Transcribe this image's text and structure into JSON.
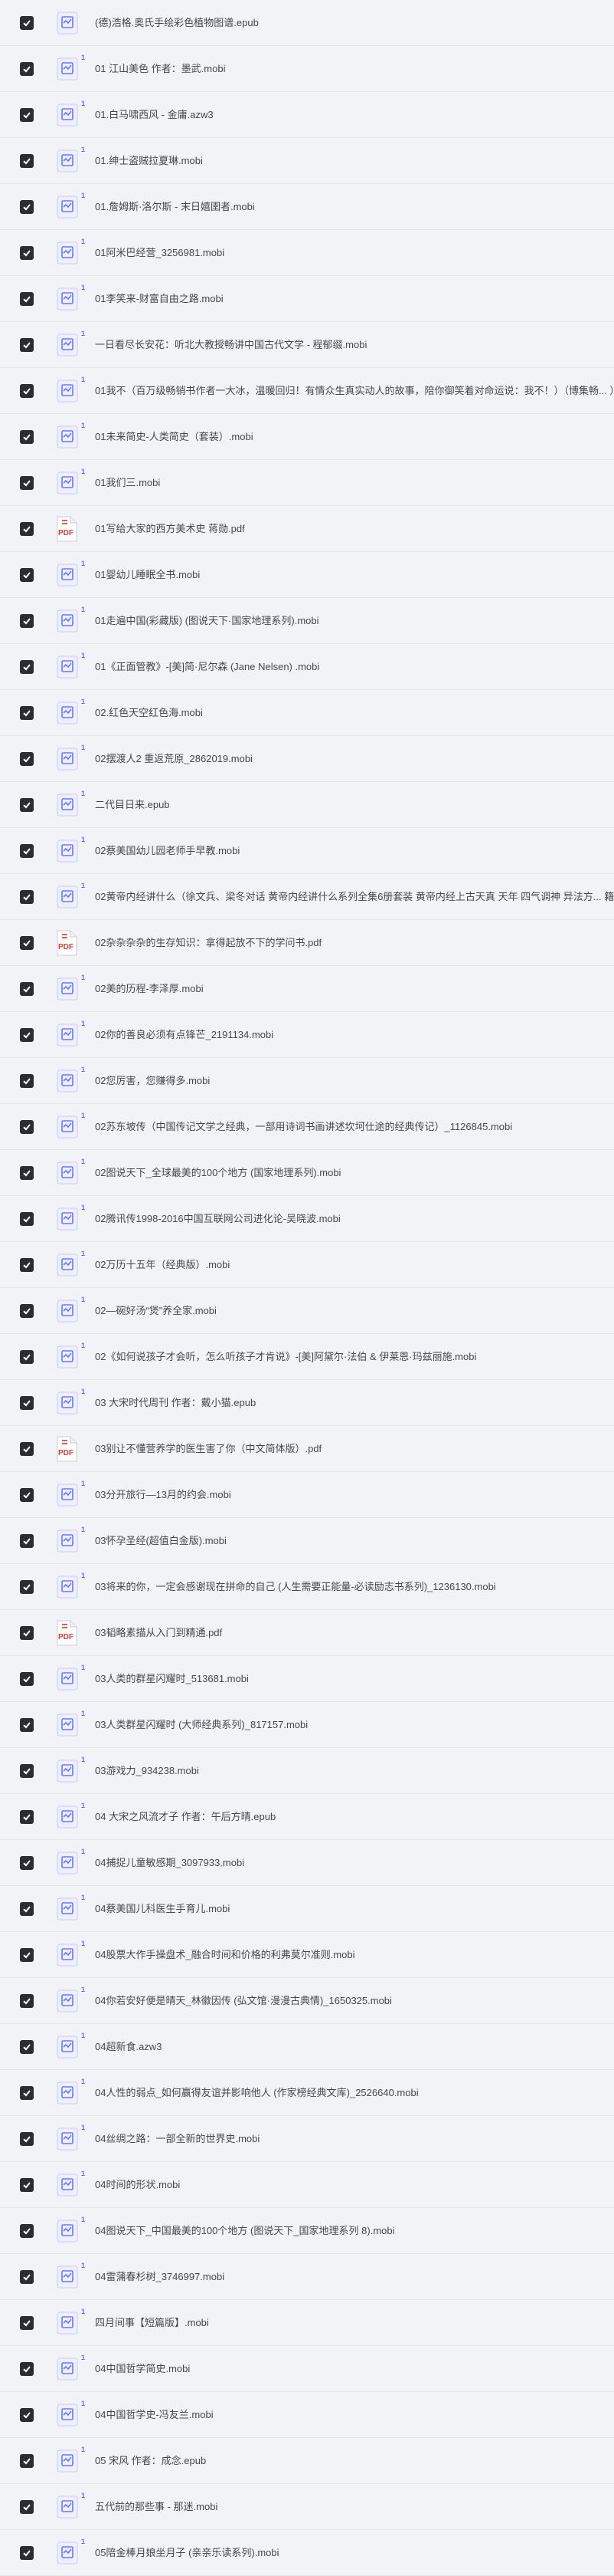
{
  "files": [
    {
      "name": "(德)浩格.奥氏手绘彩色植物图谱.epub",
      "type": "ebook",
      "count": ""
    },
    {
      "name": "01 江山美色 作者：墨武.mobi",
      "type": "ebook",
      "count": "1"
    },
    {
      "name": "01.白马啸西风 - 金庸.azw3",
      "type": "ebook",
      "count": "1"
    },
    {
      "name": "01.绅士盗贼拉夏琳.mobi",
      "type": "ebook",
      "count": "1"
    },
    {
      "name": "01.詹姆斯·洛尔斯 - 末日嬉圉者.mobi",
      "type": "ebook",
      "count": "1"
    },
    {
      "name": "01阿米巴经营_3256981.mobi",
      "type": "ebook",
      "count": "1"
    },
    {
      "name": "01李笑来-财富自由之路.mobi",
      "type": "ebook",
      "count": "1"
    },
    {
      "name": "一日看尽长安花：听北大教授畅讲中国古代文学 - 程郁缀.mobi",
      "type": "ebook",
      "count": "1"
    },
    {
      "name": "01我不（百万级畅销书作者一大冰，温暖回归！有情众生真实动人的故事，陪你御笑着对命运说：我不！）（博集畅... ）",
      "type": "ebook",
      "count": "1"
    },
    {
      "name": "01未来简史-人类简史（套装）.mobi",
      "type": "ebook",
      "count": "1"
    },
    {
      "name": "01我们三.mobi",
      "type": "ebook",
      "count": "1"
    },
    {
      "name": "01写给大家的西方美术史 蒋勋.pdf",
      "type": "pdf",
      "count": ""
    },
    {
      "name": "01婴幼儿睡眠全书.mobi",
      "type": "ebook",
      "count": "1"
    },
    {
      "name": "01走遍中国(彩藏版) (图说天下·国家地理系列).mobi",
      "type": "ebook",
      "count": "1"
    },
    {
      "name": "01《正面管教》-[美]简·尼尔森 (Jane Nelsen) .mobi",
      "type": "ebook",
      "count": "1"
    },
    {
      "name": "02.红色天空红色海.mobi",
      "type": "ebook",
      "count": "1"
    },
    {
      "name": "02摆渡人2 重返荒原_2862019.mobi",
      "type": "ebook",
      "count": "1"
    },
    {
      "name": "二代目日来.epub",
      "type": "ebook",
      "count": "1"
    },
    {
      "name": "02蔡美国幼儿园老师手早教.mobi",
      "type": "ebook",
      "count": "1"
    },
    {
      "name": "02黄帝内经讲什么（徐文兵、梁冬对话 黄帝内经讲什么系列全集6册套装 黄帝内经上古天真 天年 四气调神 异法方... 籍",
      "type": "ebook",
      "count": "1"
    },
    {
      "name": "02杂杂杂杂的生存知识：拿得起放不下的学问书.pdf",
      "type": "pdf",
      "count": ""
    },
    {
      "name": "02美的历程-李泽厚.mobi",
      "type": "ebook",
      "count": "1"
    },
    {
      "name": "02你的善良必须有点锋芒_2191134.mobi",
      "type": "ebook",
      "count": "1"
    },
    {
      "name": "02您厉害，您赚得多.mobi",
      "type": "ebook",
      "count": "1"
    },
    {
      "name": "02苏东坡传（中国传记文学之经典，一部用诗词书画讲述坎坷仕途的经典传记）_1126845.mobi",
      "type": "ebook",
      "count": "1"
    },
    {
      "name": "02图说天下_全球最美的100个地方 (国家地理系列).mobi",
      "type": "ebook",
      "count": "1"
    },
    {
      "name": "02腾讯传1998-2016中国互联网公司进化论-吴晓波.mobi",
      "type": "ebook",
      "count": "1"
    },
    {
      "name": "02万历十五年（经典版）.mobi",
      "type": "ebook",
      "count": "1"
    },
    {
      "name": "02—碗好汤“煲”养全家.mobi",
      "type": "ebook",
      "count": "1"
    },
    {
      "name": "02《如何说孩子才会听，怎么听孩子才肯说》-[美]阿黛尔·法伯 & 伊莱恩·玛兹丽施.mobi",
      "type": "ebook",
      "count": "1"
    },
    {
      "name": "03 大宋时代周刊 作者：戴小猫.epub",
      "type": "ebook",
      "count": "1"
    },
    {
      "name": "03别让不懂营养学的医生害了你（中文简体版）.pdf",
      "type": "pdf",
      "count": ""
    },
    {
      "name": "03分开旅行—13月的约会.mobi",
      "type": "ebook",
      "count": "1"
    },
    {
      "name": "03怀孕圣经(超值白金版).mobi",
      "type": "ebook",
      "count": "1"
    },
    {
      "name": "03将来的你，一定会感谢现在拼命的自己 (人生需要正能量-必读励志书系列)_1236130.mobi",
      "type": "ebook",
      "count": "1"
    },
    {
      "name": "03韬略素描从入门到精通.pdf",
      "type": "pdf",
      "count": ""
    },
    {
      "name": "03人类的群星闪耀时_513681.mobi",
      "type": "ebook",
      "count": "1"
    },
    {
      "name": "03人类群星闪耀时 (大师经典系列)_817157.mobi",
      "type": "ebook",
      "count": "1"
    },
    {
      "name": "03游戏力_934238.mobi",
      "type": "ebook",
      "count": "1"
    },
    {
      "name": "04 大宋之风流才子 作者：午后方晴.epub",
      "type": "ebook",
      "count": "1"
    },
    {
      "name": "04捕捉儿童敏感期_3097933.mobi",
      "type": "ebook",
      "count": "1"
    },
    {
      "name": "04蔡美国儿科医生手育儿.mobi",
      "type": "ebook",
      "count": "1"
    },
    {
      "name": "04股票大作手操盘术_融合时间和价格的利弗莫尔准则.mobi",
      "type": "ebook",
      "count": "1"
    },
    {
      "name": "04你若安好便是晴天_林徽因传 (弘文馆·漫漫古典情)_1650325.mobi",
      "type": "ebook",
      "count": "1"
    },
    {
      "name": "04超新食.azw3",
      "type": "ebook",
      "count": "1"
    },
    {
      "name": "04人性的弱点_如何赢得友谊并影响他人 (作家榜经典文库)_2526640.mobi",
      "type": "ebook",
      "count": "1"
    },
    {
      "name": "04丝绸之路：一部全新的世界史.mobi",
      "type": "ebook",
      "count": "1"
    },
    {
      "name": "04时间的形状.mobi",
      "type": "ebook",
      "count": "1"
    },
    {
      "name": "04图说天下_中国最美的100个地方 (图说天下_国家地理系列 8).mobi",
      "type": "ebook",
      "count": "1"
    },
    {
      "name": "04雷蒲春杉树_3746997.mobi",
      "type": "ebook",
      "count": "1"
    },
    {
      "name": "四月间事【短篇版】.mobi",
      "type": "ebook",
      "count": "1"
    },
    {
      "name": "04中国哲学简史.mobi",
      "type": "ebook",
      "count": "1"
    },
    {
      "name": "04中国哲学史-冯友兰.mobi",
      "type": "ebook",
      "count": "1"
    },
    {
      "name": "05 宋风 作者：成念.epub",
      "type": "ebook",
      "count": "1"
    },
    {
      "name": "五代前的那些事 - 那迷.mobi",
      "type": "ebook",
      "count": "1"
    },
    {
      "name": "05陪金棒月娘坐月子 (亲亲乐读系列).mobi",
      "type": "ebook",
      "count": "1"
    }
  ]
}
